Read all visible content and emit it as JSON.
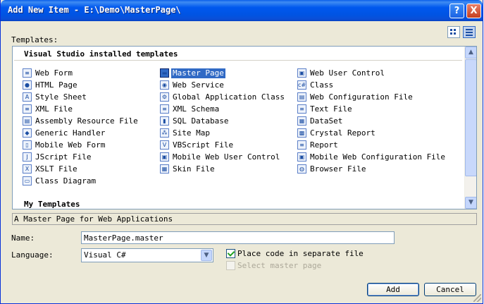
{
  "window": {
    "title": "Add New Item - E:\\Demo\\MasterPage\\",
    "help_glyph": "?",
    "close_glyph": "X"
  },
  "templates_label": "Templates:",
  "groups": {
    "installed": "Visual Studio installed templates",
    "mine": "My Templates"
  },
  "columns": [
    [
      {
        "label": "Web Form",
        "icon": "web-form-icon",
        "glyph": "≡"
      },
      {
        "label": "HTML Page",
        "icon": "html-page-icon",
        "glyph": "●"
      },
      {
        "label": "Style Sheet",
        "icon": "style-sheet-icon",
        "glyph": "A"
      },
      {
        "label": "XML File",
        "icon": "xml-file-icon",
        "glyph": "≡"
      },
      {
        "label": "Assembly Resource File",
        "icon": "resource-file-icon",
        "glyph": "▤"
      },
      {
        "label": "Generic Handler",
        "icon": "generic-handler-icon",
        "glyph": "◆"
      },
      {
        "label": "Mobile Web Form",
        "icon": "mobile-web-form-icon",
        "glyph": "▯"
      },
      {
        "label": "JScript File",
        "icon": "jscript-file-icon",
        "glyph": "J"
      },
      {
        "label": "XSLT File",
        "icon": "xslt-file-icon",
        "glyph": "X"
      },
      {
        "label": "Class Diagram",
        "icon": "class-diagram-icon",
        "glyph": "▭"
      }
    ],
    [
      {
        "label": "Master Page",
        "icon": "master-page-icon",
        "glyph": "▬"
      },
      {
        "label": "Web Service",
        "icon": "web-service-icon",
        "glyph": "◉"
      },
      {
        "label": "Global Application Class",
        "icon": "global-app-class-icon",
        "glyph": "⚙"
      },
      {
        "label": "XML Schema",
        "icon": "xml-schema-icon",
        "glyph": "≡"
      },
      {
        "label": "SQL Database",
        "icon": "sql-database-icon",
        "glyph": "▮"
      },
      {
        "label": "Site Map",
        "icon": "site-map-icon",
        "glyph": "⁂"
      },
      {
        "label": "VBScript File",
        "icon": "vbscript-file-icon",
        "glyph": "V"
      },
      {
        "label": "Mobile Web User Control",
        "icon": "mobile-user-control-icon",
        "glyph": "▣"
      },
      {
        "label": "Skin File",
        "icon": "skin-file-icon",
        "glyph": "▦"
      }
    ],
    [
      {
        "label": "Web User Control",
        "icon": "web-user-control-icon",
        "glyph": "▣"
      },
      {
        "label": "Class",
        "icon": "class-icon",
        "glyph": "c#"
      },
      {
        "label": "Web Configuration File",
        "icon": "web-config-icon",
        "glyph": "▤"
      },
      {
        "label": "Text File",
        "icon": "text-file-icon",
        "glyph": "≡"
      },
      {
        "label": "DataSet",
        "icon": "dataset-icon",
        "glyph": "▦"
      },
      {
        "label": "Crystal Report",
        "icon": "crystal-report-icon",
        "glyph": "▩"
      },
      {
        "label": "Report",
        "icon": "report-icon",
        "glyph": "≡"
      },
      {
        "label": "Mobile Web Configuration File",
        "icon": "mobile-web-config-icon",
        "glyph": "▣"
      },
      {
        "label": "Browser File",
        "icon": "browser-file-icon",
        "glyph": "◍"
      }
    ]
  ],
  "selected_item": "Master Page",
  "description": "A Master Page for Web Applications",
  "name_field": {
    "label": "Name:",
    "value": "MasterPage.master"
  },
  "language": {
    "label": "Language:",
    "value": "Visual C#",
    "arrow": "▼"
  },
  "options": {
    "place_code": {
      "label": "Place code in separate file",
      "checked": true
    },
    "select_master": {
      "label": "Select master page",
      "checked": false,
      "enabled": false
    }
  },
  "buttons": {
    "add": "Add",
    "cancel": "Cancel"
  },
  "scroll": {
    "up": "▲",
    "down": "▼"
  },
  "colors": {
    "title_bar": "#0054e3",
    "selection": "#316ac5",
    "dialog": "#ece9d8"
  }
}
